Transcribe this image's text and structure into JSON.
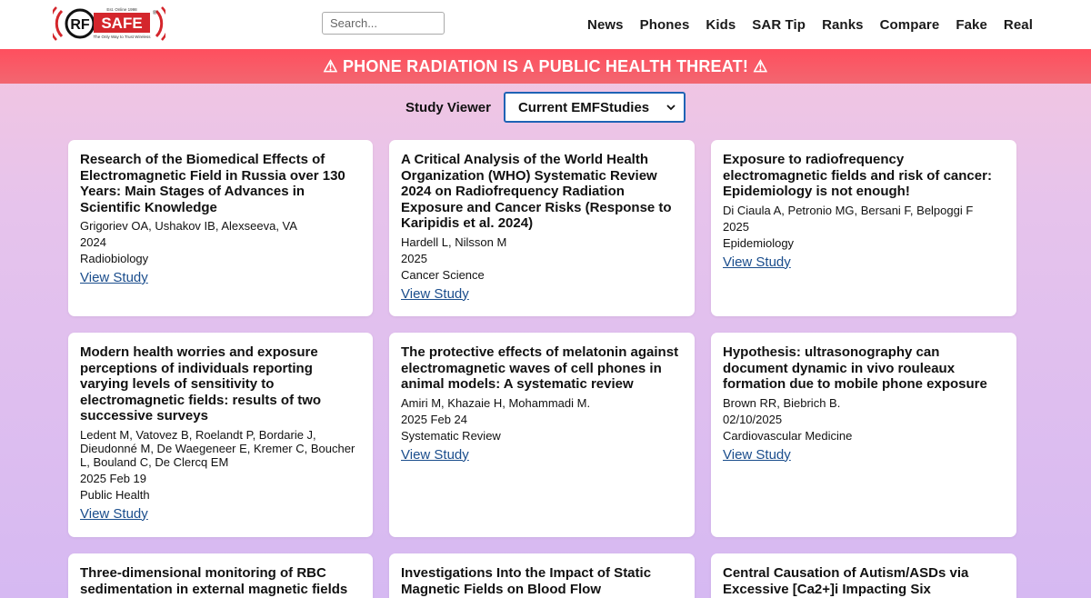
{
  "header": {
    "logo": {
      "text": "RFSAFE",
      "est": "Est. Online 1998",
      "tagline": "The Only Way to Trust Wireless"
    },
    "search_placeholder": "Search...",
    "nav": [
      "News",
      "Phones",
      "Kids",
      "SAR Tip",
      "Ranks",
      "Compare",
      "Fake",
      "Real"
    ]
  },
  "banner": {
    "text": "⚠ PHONE RADIATION IS A PUBLIC HEALTH THREAT! ⚠"
  },
  "viewer": {
    "label": "Study Viewer",
    "selected": "Current EMFStudies"
  },
  "studies": [
    {
      "title": "Research of the Biomedical Effects of Electromagnetic Field in Russia over 130 Years: Main Stages of Advances in Scientific Knowledge",
      "authors": "Grigoriev OA, Ushakov IB, Alexseeva, VA",
      "date": "2024",
      "journal": "Radiobiology",
      "link": "View Study"
    },
    {
      "title": "A Critical Analysis of the World Health Organization (WHO) Systematic Review 2024 on Radiofrequency Radiation Exposure and Cancer Risks (Response to Karipidis et al. 2024)",
      "authors": "Hardell L, Nilsson M",
      "date": "2025",
      "journal": "Cancer Science",
      "link": "View Study"
    },
    {
      "title": "Exposure to radiofrequency electromagnetic fields and risk of cancer: Epidemiology is not enough!",
      "authors": "Di Ciaula A, Petronio MG, Bersani F, Belpoggi F",
      "date": "2025",
      "journal": "Epidemiology",
      "link": "View Study"
    },
    {
      "title": "Modern health worries and exposure perceptions of individuals reporting varying levels of sensitivity to electromagnetic fields: results of two successive surveys",
      "authors": "Ledent M, Vatovez B, Roelandt P, Bordarie J, Dieudonné M, De Waegeneer E, Kremer C, Boucher L, Bouland C, De Clercq EM",
      "date": "2025 Feb 19",
      "journal": "Public Health",
      "link": "View Study"
    },
    {
      "title": "The protective effects of melatonin against electromagnetic waves of cell phones in animal models: A systematic review",
      "authors": "Amiri M, Khazaie H, Mohammadi M.",
      "date": "2025 Feb 24",
      "journal": "Systematic Review",
      "link": "View Study"
    },
    {
      "title": "Hypothesis: ultrasonography can document dynamic in vivo rouleaux formation due to mobile phone exposure",
      "authors": "Brown RR, Biebrich B.",
      "date": "02/10/2025",
      "journal": "Cardiovascular Medicine",
      "link": "View Study"
    },
    {
      "title": "Three-dimensional monitoring of RBC sedimentation in external magnetic fields",
      "authors": "",
      "date": "",
      "journal": "",
      "link": ""
    },
    {
      "title": "Investigations Into the Impact of Static Magnetic Fields on Blood Flow",
      "authors": "",
      "date": "",
      "journal": "",
      "link": ""
    },
    {
      "title": "Central Causation of Autism/ASDs via Excessive [Ca2+]i Impacting Six",
      "authors": "",
      "date": "",
      "journal": "",
      "link": ""
    }
  ]
}
